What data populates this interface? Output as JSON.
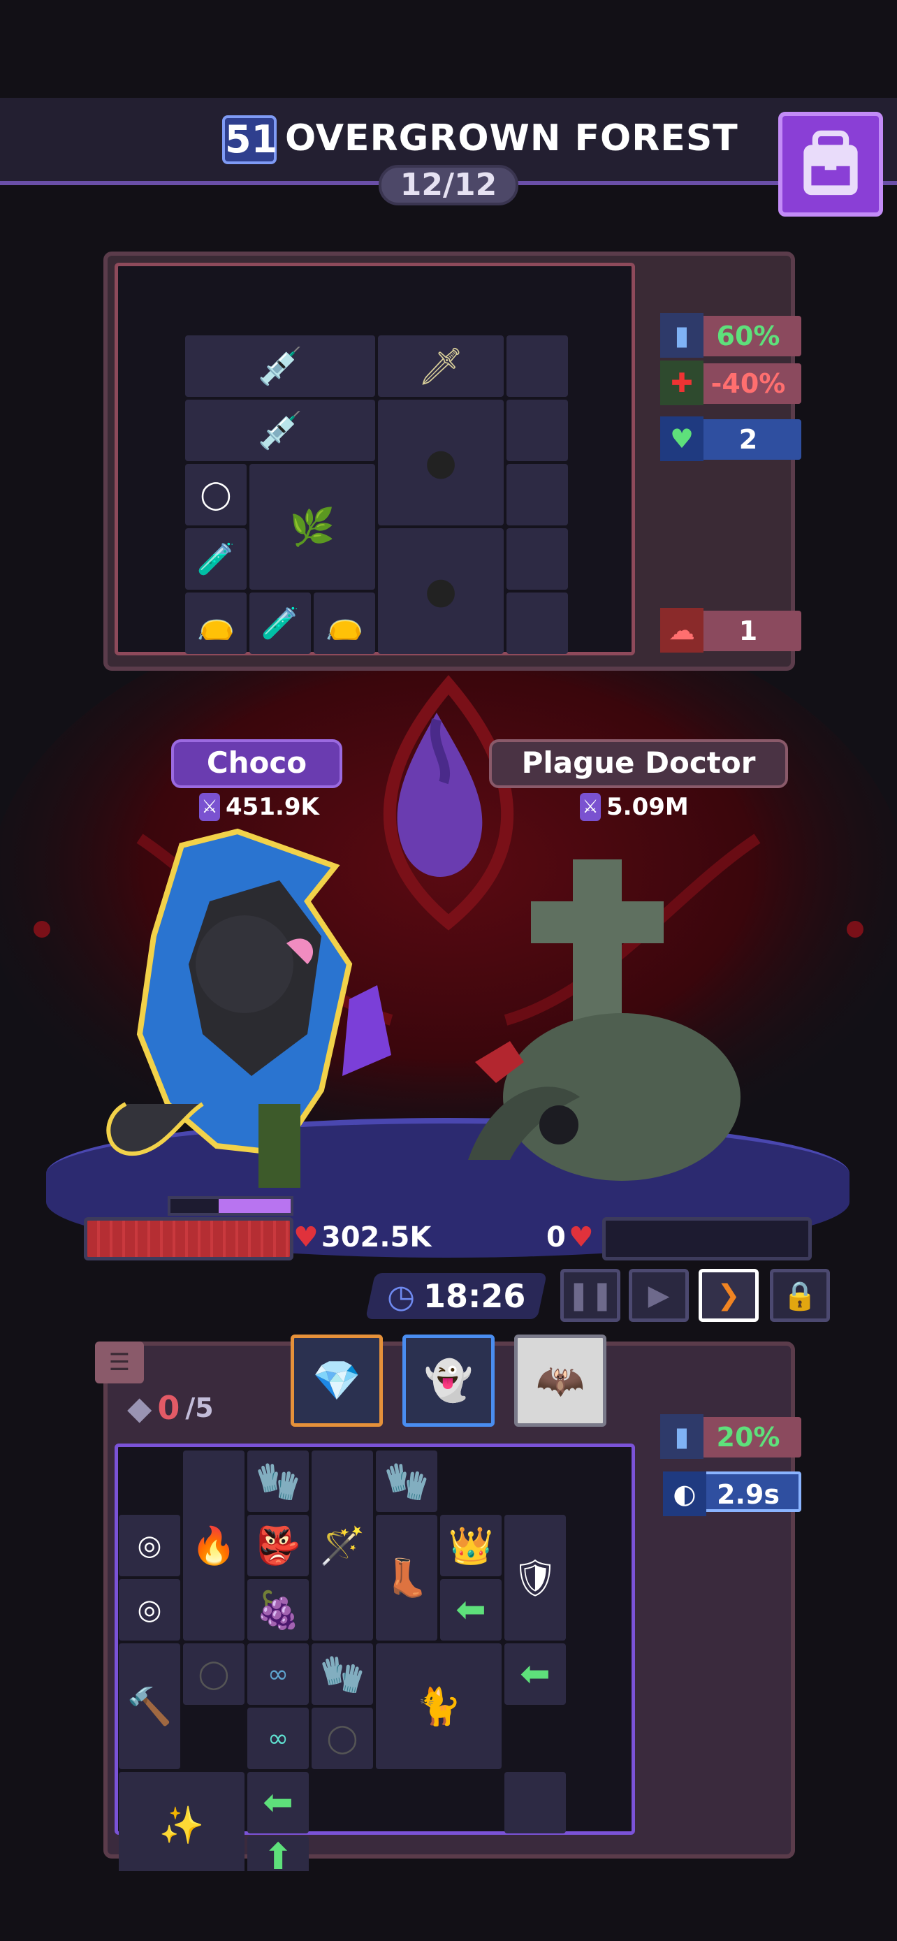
{
  "header": {
    "level": "51",
    "stage_name": "OVERGROWN FOREST",
    "wave_progress": "12/12",
    "bag_icon": "backpack-icon"
  },
  "enemy_stats": [
    {
      "icon": "attack-speed-icon",
      "value": "60%",
      "color": "#5ee07b"
    },
    {
      "icon": "heal-reduction-icon",
      "value": "-40%",
      "color": "#ff6f6f"
    },
    {
      "icon": "shield-heart-icon",
      "value": "2",
      "color": "#ffffff"
    },
    {
      "icon": "rage-icon",
      "value": "1",
      "color": "#ffffff"
    }
  ],
  "player": {
    "name": "Choco",
    "power": "451.9K",
    "hp_text": "302.5K"
  },
  "enemy": {
    "name": "Plague Doctor",
    "power": "5.09M",
    "hp_text": "0"
  },
  "battle": {
    "timer": "18:26",
    "controls": [
      "pause-icon",
      "play-icon",
      "fast-forward-icon",
      "lock-icon"
    ]
  },
  "inventory": {
    "slots_used": "0",
    "slots_max": "/5",
    "stats": [
      {
        "icon": "attack-speed-icon",
        "value": "20%",
        "color": "#5ee07b"
      },
      {
        "icon": "cooldown-icon",
        "value": "2.9s",
        "color": "#ffffff"
      }
    ]
  },
  "colors": {
    "accent_purple": "#7b53d8",
    "hp_red": "#c9393e",
    "stat_green": "#5ee07b",
    "stat_red": "#ff6f6f"
  }
}
